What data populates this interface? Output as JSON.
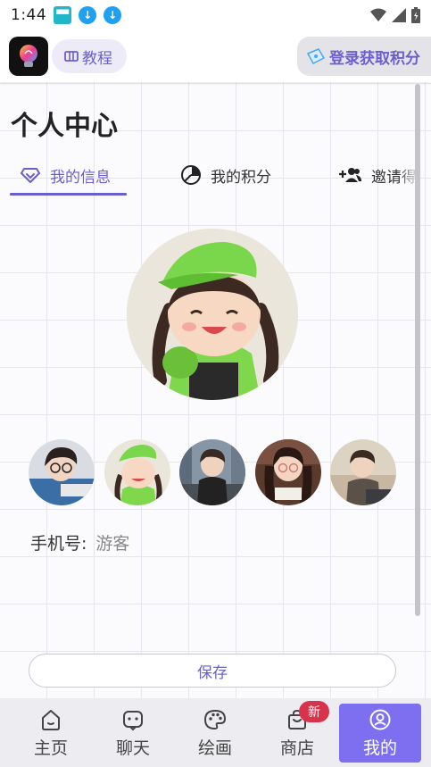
{
  "status_bar": {
    "time": "1:44"
  },
  "header": {
    "tutorial_label": "教程",
    "login_label": "登录获取积分"
  },
  "page": {
    "title": "个人中心"
  },
  "tabs": [
    {
      "label": "我的信息",
      "icon": "diamond-icon",
      "active": true
    },
    {
      "label": "我的积分",
      "icon": "pie-chart-icon",
      "active": false
    },
    {
      "label": "邀请得",
      "icon": "add-user-icon",
      "active": false
    }
  ],
  "profile": {
    "phone_label": "手机号:",
    "phone_value": "游客",
    "save_label": "保存"
  },
  "bottom_nav": [
    {
      "label": "主页",
      "icon": "home-icon"
    },
    {
      "label": "聊天",
      "icon": "chat-icon"
    },
    {
      "label": "绘画",
      "icon": "palette-icon"
    },
    {
      "label": "商店",
      "icon": "shopping-bag-icon",
      "badge": "新"
    },
    {
      "label": "我的",
      "icon": "user-icon",
      "active": true
    }
  ],
  "colors": {
    "accent": "#6a5fd1",
    "nav_active_bg": "#7e6ff0",
    "badge": "#d8334a"
  }
}
